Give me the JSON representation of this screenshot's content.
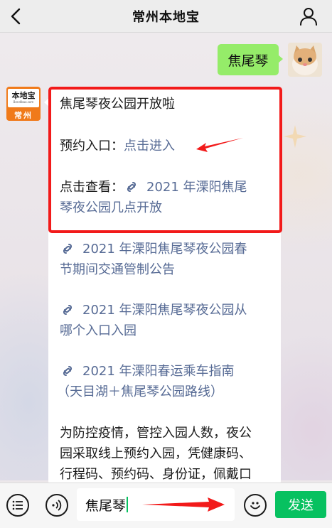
{
  "header": {
    "title": "常州本地宝"
  },
  "sent": {
    "text": "焦尾琴"
  },
  "bot": {
    "avatar_logo": "本地宝",
    "avatar_sub": "Bendibao.com",
    "avatar_city": "常州",
    "messages": {
      "title": "焦尾琴夜公园开放啦",
      "reserve_label": "预约入口：",
      "reserve_link": "点击进入",
      "view_label": "点击查看：",
      "link1_a": "2021 年溧阳焦尾",
      "link1_b": "琴夜公园几点开放",
      "link2_a": "2021 年溧阳焦尾琴夜公园春",
      "link2_b": "节期间交通管制公告",
      "link3_a": "2021 年溧阳焦尾琴夜公园从",
      "link3_b": "哪个入口入园",
      "link4_a": "2021 年溧阳春运乘车指南",
      "link4_b": "（天目湖＋焦尾琴公园路线）",
      "para1": "为防控疫情，管控入园人数，夜公",
      "para2": "园采取线上预约入园，凭健康码、",
      "para3": "行程码、预约码、身份证，佩戴口"
    }
  },
  "inputbar": {
    "input_value": "焦尾琴",
    "send_label": "发送"
  },
  "colors": {
    "accent": "#07c160",
    "bubble_me": "#95ec69",
    "link": "#576b95",
    "highlight": "#f21a1a"
  },
  "icons": [
    "back-icon",
    "profile-icon",
    "miniprogram-icon",
    "list-icon",
    "voice-icon",
    "emoji-icon",
    "arrow-annotation"
  ]
}
